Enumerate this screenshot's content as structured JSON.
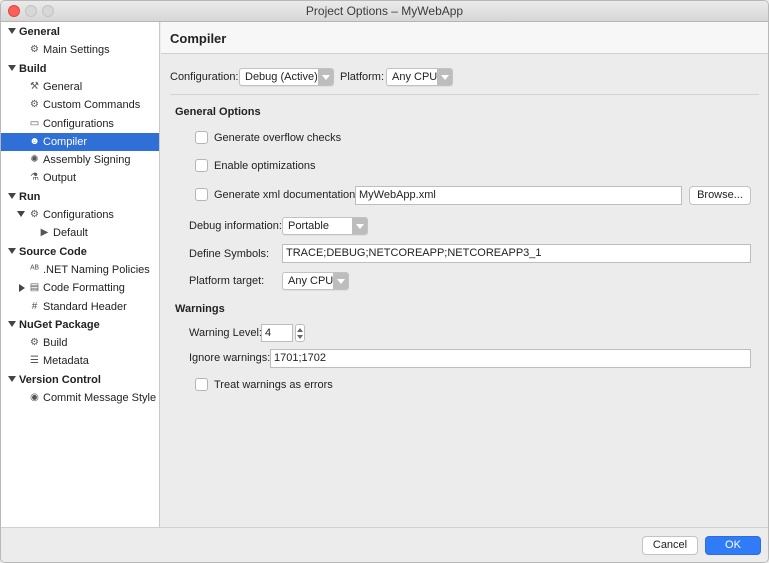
{
  "window": {
    "title": "Project Options – MyWebApp"
  },
  "sidebar": {
    "items": [
      {
        "label": "General",
        "type": "section",
        "expanded": true,
        "icon": "disclosure-down"
      },
      {
        "label": "Main Settings",
        "type": "item",
        "icon": "gear-icon"
      },
      {
        "label": "Build",
        "type": "section",
        "expanded": true,
        "icon": "disclosure-down"
      },
      {
        "label": "General",
        "type": "item",
        "icon": "hammer-icon"
      },
      {
        "label": "Custom Commands",
        "type": "item",
        "icon": "gear-icon"
      },
      {
        "label": "Configurations",
        "type": "item",
        "icon": "window-icon"
      },
      {
        "label": "Compiler",
        "type": "item",
        "icon": "robot-icon",
        "selected": true
      },
      {
        "label": "Assembly Signing",
        "type": "item",
        "icon": "seal-icon"
      },
      {
        "label": "Output",
        "type": "item",
        "icon": "flask-icon"
      },
      {
        "label": "Run",
        "type": "section",
        "expanded": true,
        "icon": "disclosure-down"
      },
      {
        "label": "Configurations",
        "type": "item",
        "icon": "gear-icon",
        "expandable": true
      },
      {
        "label": "Default",
        "type": "subitem",
        "icon": "play-icon"
      },
      {
        "label": "Source Code",
        "type": "section",
        "expanded": true,
        "icon": "disclosure-down"
      },
      {
        "label": ".NET Naming Policies",
        "type": "item",
        "icon": "abc-icon"
      },
      {
        "label": "Code Formatting",
        "type": "item",
        "icon": "document-icon",
        "expandable": true
      },
      {
        "label": "Standard Header",
        "type": "item",
        "icon": "hash-icon"
      },
      {
        "label": "NuGet Package",
        "type": "section",
        "expanded": true,
        "icon": "disclosure-down"
      },
      {
        "label": "Build",
        "type": "item",
        "icon": "gear-icon"
      },
      {
        "label": "Metadata",
        "type": "item",
        "icon": "list-icon"
      },
      {
        "label": "Version Control",
        "type": "section",
        "expanded": true,
        "icon": "disclosure-down"
      },
      {
        "label": "Commit Message Style",
        "type": "item",
        "icon": "commit-icon"
      }
    ]
  },
  "content": {
    "title": "Compiler",
    "configuration_label": "Configuration:",
    "configuration_value": "Debug (Active)",
    "platform_label": "Platform:",
    "platform_value": "Any CPU",
    "general_options_heading": "General Options",
    "overflow_label": "Generate overflow checks",
    "overflow_checked": false,
    "optimizations_label": "Enable optimizations",
    "optimizations_checked": false,
    "xmldoc_label": "Generate xml documentation:",
    "xmldoc_checked": false,
    "xmldoc_value": "MyWebApp.xml",
    "browse_label": "Browse...",
    "debug_info_label": "Debug information:",
    "debug_info_value": "Portable",
    "define_symbols_label": "Define Symbols:",
    "define_symbols_value": "TRACE;DEBUG;NETCOREAPP;NETCOREAPP3_1",
    "platform_target_label": "Platform target:",
    "platform_target_value": "Any CPU",
    "warnings_heading": "Warnings",
    "warning_level_label": "Warning Level:",
    "warning_level_value": "4",
    "ignore_warnings_label": "Ignore warnings:",
    "ignore_warnings_value": "1701;1702",
    "treat_warnings_label": "Treat warnings as errors",
    "treat_warnings_checked": false
  },
  "footer": {
    "cancel_label": "Cancel",
    "ok_label": "OK"
  },
  "colors": {
    "selection": "#2f6fd6",
    "primary_button": "#2f7cf6",
    "close_button": "#fc5f57"
  }
}
